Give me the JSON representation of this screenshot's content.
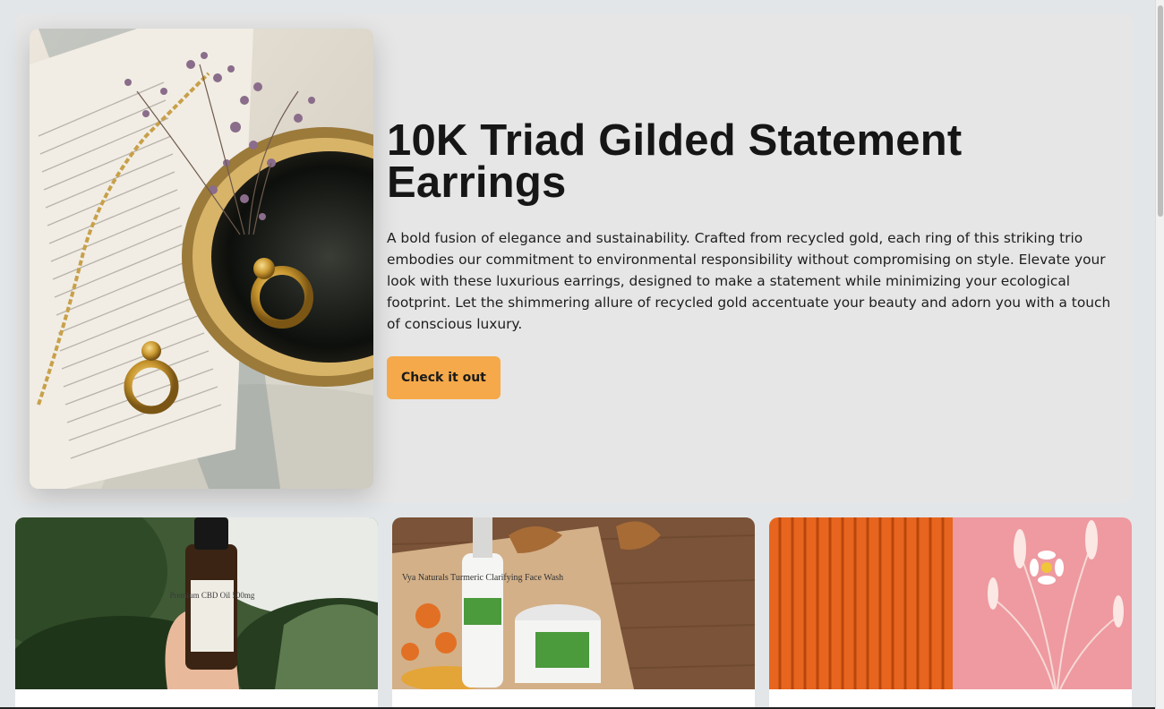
{
  "hero": {
    "title": "10K Triad Gilded Statement Earrings",
    "description": "A bold fusion of elegance and sustainability. Crafted from recycled gold, each ring of this striking trio embodies our commitment to environmental responsibility without compromising on style. Elevate your look with these luxurious earrings, designed to make a statement while minimizing your ecological footprint. Let the shimmering allure of recycled gold accentuate your beauty and adorn you with a touch of conscious luxury.",
    "cta_label": "Check it out",
    "cta_color": "#f5a94a"
  },
  "cards": [
    {
      "product_label": "Premium CBD Oil 500mg"
    },
    {
      "product_label": "Vya Naturals Turmeric Clarifying Face Wash"
    },
    {
      "product_label": "Dried flower bouquet"
    }
  ],
  "colors": {
    "background": "#e3e6e8",
    "hero_background": "#e6e6e6",
    "text": "#161616"
  }
}
